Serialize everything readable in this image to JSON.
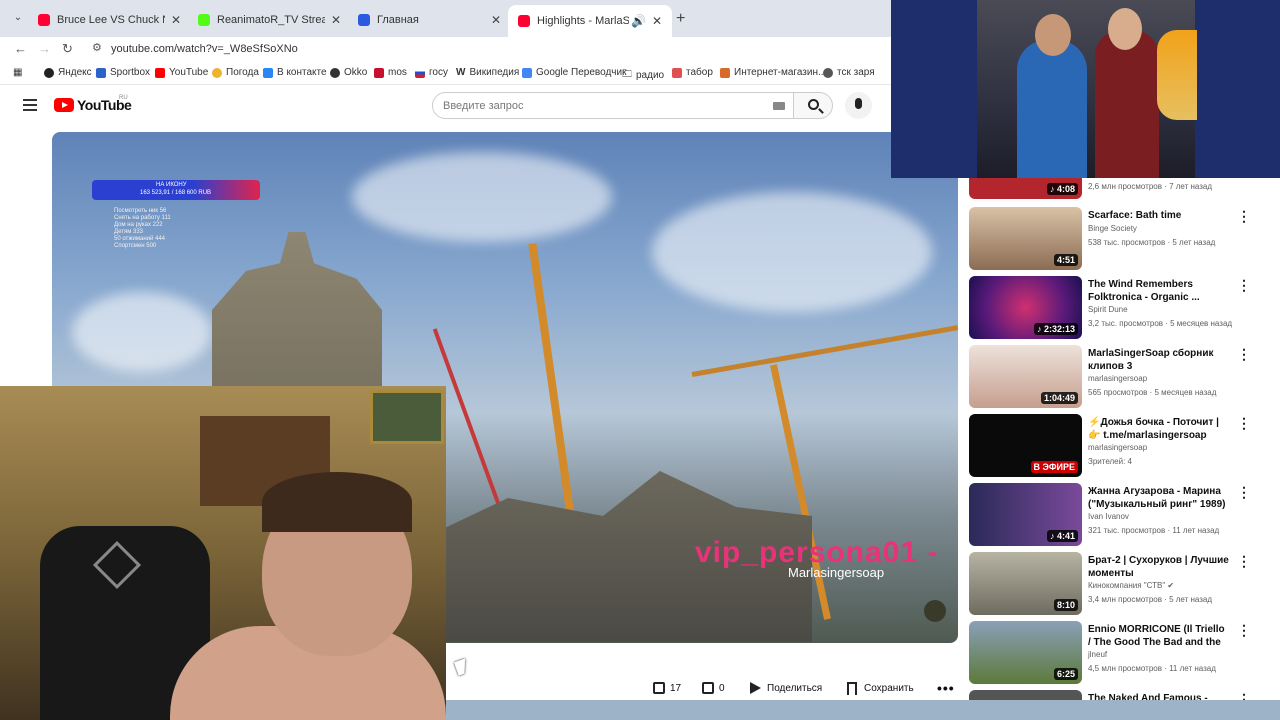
{
  "browser": {
    "tabs": [
      {
        "label": "Bruce Lee VS Chuck Norris Full",
        "color": "#ff0033"
      },
      {
        "label": "ReanimatoR_TV Stream - Watch",
        "color": "#53fc18"
      },
      {
        "label": "Главная",
        "color": "#2a5adf"
      },
      {
        "label": "Highlights - MarlaSingerSoap",
        "color": "#ff0033"
      }
    ],
    "url": "youtube.com/watch?v=_W8eSfSoXNo",
    "bookmarks": [
      "Яндекс",
      "Sportbox",
      "YouTube",
      "Погода",
      "В контакте",
      "Okko",
      "mos",
      "госу",
      "Википедия",
      "Google Переводчик",
      "радио",
      "табор",
      "Интернет-магазин...",
      "тск заря"
    ]
  },
  "youtube": {
    "logo_text": "YouTube",
    "region": "RU",
    "search_placeholder": "Введите запрос"
  },
  "video": {
    "overlay_title": "НА ИКОНУ",
    "overlay_amount": "163 523,91 / 168 600 RUB",
    "overlay_stats": [
      "Посмотреть ник 56",
      "Снять на работу 111",
      "Дом на руках 222",
      "Детям 333",
      "50 отжиманий 444",
      "Спортсмен 500"
    ],
    "watermark_main": "vip_persona01 -",
    "watermark_sub": "Marlasingersoap",
    "like_count": "17",
    "dislike_count": "0",
    "share_label": "Поделиться",
    "save_label": "Сохранить"
  },
  "recommendations": [
    {
      "title": "",
      "channel": "",
      "meta": "2,6 млн просмотров · 7 лет назад",
      "duration": "♪ 4:08",
      "color": "#b3262e"
    },
    {
      "title": "Scarface: Bath time",
      "channel": "Binge Society",
      "meta": "538 тыс. просмотров · 5 лет назад",
      "duration": "4:51",
      "color": "#a4886a"
    },
    {
      "title": "The Wind Remembers Folktronica - Organic ...",
      "channel": "Spirit Dune",
      "meta": "3,2 тыс. просмотров · 5 месяцев назад",
      "duration": "♪ 2:32:13",
      "color": "#7a2a8a"
    },
    {
      "title": "MarlaSingerSoap сборник клипов 3",
      "channel": "marlasingersoap",
      "meta": "565 просмотров · 5 месяцев назад",
      "duration": "1:04:49",
      "color": "#d6b8a8"
    },
    {
      "title": "⚡Дожья бочка - Поточит | 👉 t.me/marlasingersoap",
      "channel": "marlasingersoap",
      "meta": "Зрителей: 4",
      "duration": "В ЭФИРЕ",
      "color": "#0a0a0a"
    },
    {
      "title": "Жанна Агузарова - Марина (\"Музыкальный ринг\" 1989)",
      "channel": "Ivan Ivanov",
      "meta": "321 тыс. просмотров · 11 лет назад",
      "duration": "♪ 4:41",
      "color": "#3b3658"
    },
    {
      "title": "Брат-2 | Сухоруков | Лучшие моменты",
      "channel": "Кинокомпания \"СТВ\" ✔",
      "meta": "3,4 млн просмотров · 5 лет назад",
      "duration": "8:10",
      "color": "#8c8a7c"
    },
    {
      "title": "Ennio MORRICONE (Il Triello / The Good The Bad and the Ugl...",
      "channel": "jlneuf",
      "meta": "4,5 млн просмотров · 11 лет назад",
      "duration": "6:25",
      "color": "#6e8a4a"
    },
    {
      "title": "The Naked And Famous -",
      "channel": "",
      "meta": "",
      "duration": "",
      "color": "#555555"
    }
  ]
}
